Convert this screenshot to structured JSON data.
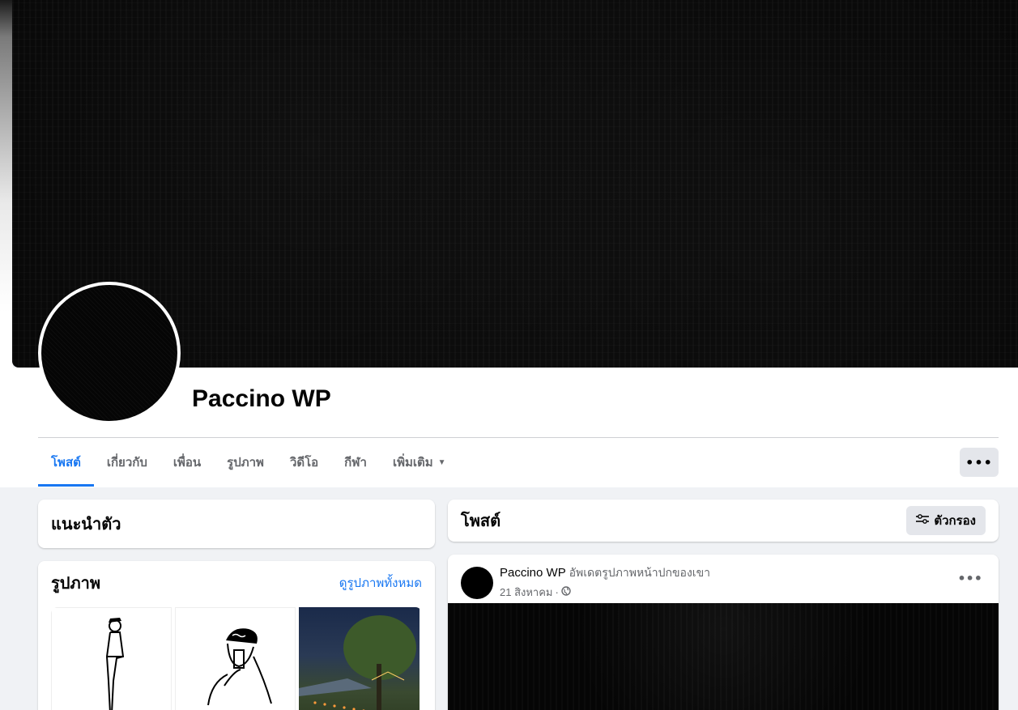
{
  "profile": {
    "name": "Paccino WP"
  },
  "tabs": [
    {
      "label": "โพสต์",
      "active": true
    },
    {
      "label": "เกี่ยวกับ"
    },
    {
      "label": "เพื่อน"
    },
    {
      "label": "รูปภาพ"
    },
    {
      "label": "วิดีโอ"
    },
    {
      "label": "กีฬา"
    },
    {
      "label": "เพิ่มเติม"
    }
  ],
  "more_button": {
    "label": "•••"
  },
  "intro": {
    "title": "แนะนำตัว"
  },
  "photos": {
    "title": "รูปภาพ",
    "see_all": "ดูรูปภาพทั้งหมด"
  },
  "posts": {
    "title": "โพสต์",
    "filter_label": "ตัวกรอง"
  },
  "post": {
    "author": "Paccino WP",
    "action": "อัพเดตรูปภาพหน้าปกของเขา",
    "date": "21 สิงหาคม",
    "separator": "·",
    "menu": "•••"
  },
  "colors": {
    "accent": "#1877f2",
    "background": "#f0f2f5"
  }
}
